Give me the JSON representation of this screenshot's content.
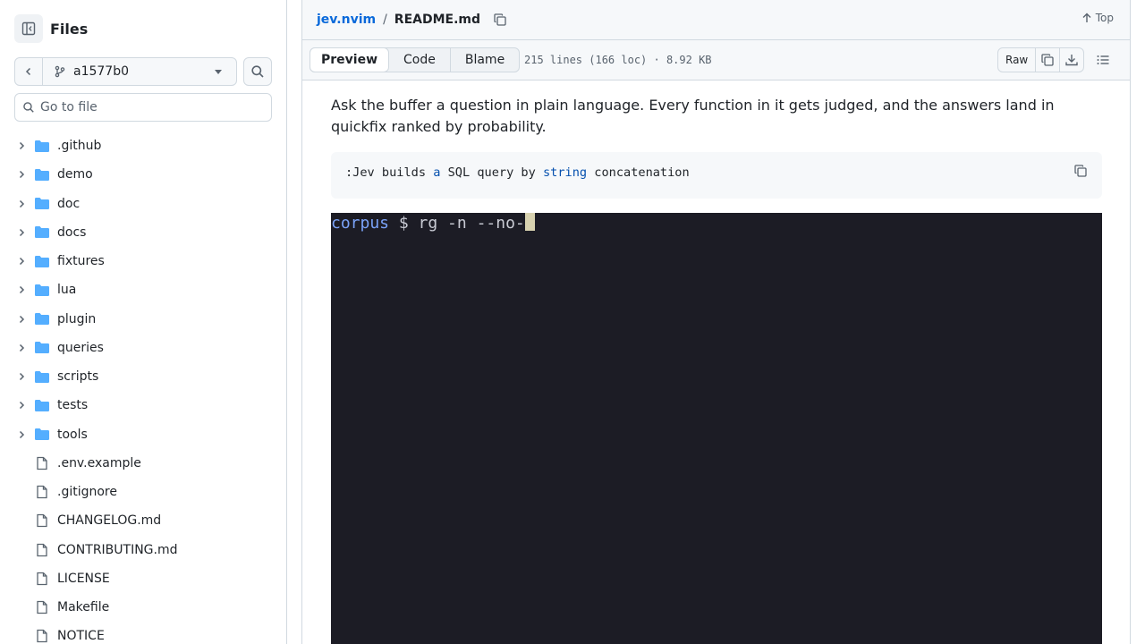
{
  "sidebar": {
    "title": "Files",
    "branch": "a1577b0",
    "goto_placeholder": "Go to file",
    "folders": [
      ".github",
      "demo",
      "doc",
      "docs",
      "fixtures",
      "lua",
      "plugin",
      "queries",
      "scripts",
      "tests",
      "tools"
    ],
    "files": [
      ".env.example",
      ".gitignore",
      "CHANGELOG.md",
      "CONTRIBUTING.md",
      "LICENSE",
      "Makefile",
      "NOTICE"
    ]
  },
  "breadcrumb": {
    "repo": "jev.nvim",
    "separator": "/",
    "file": "README.md",
    "top_label": "Top"
  },
  "toolbar": {
    "tabs": [
      "Preview",
      "Code",
      "Blame"
    ],
    "active_tab": "Preview",
    "file_meta": "215 lines (166 loc) · 8.92 KB",
    "raw_label": "Raw"
  },
  "content": {
    "paragraph": "Ask the buffer a question in plain language. Every function in it gets judged, and the answers land in quickfix ranked by probability.",
    "code": {
      "p1": ":Jev builds ",
      "k1": "a",
      "p2": " SQL query by ",
      "k2": "string",
      "p3": " concatenation"
    },
    "terminal": {
      "cwd": "corpus",
      "prompt": " $ ",
      "command": "rg -n --no-"
    }
  },
  "colors": {
    "link": "#0969da",
    "folder": "#54aeff",
    "terminal_bg": "#1c1c25",
    "terminal_cwd": "#7aa2f7"
  }
}
